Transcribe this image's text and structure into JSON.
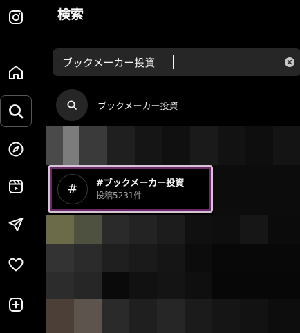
{
  "sidebar": {
    "items": [
      {
        "name": "instagram-logo",
        "icon": "instagram-icon"
      },
      {
        "name": "home",
        "icon": "home-icon"
      },
      {
        "name": "search",
        "icon": "search-icon",
        "active": true
      },
      {
        "name": "explore",
        "icon": "compass-icon"
      },
      {
        "name": "reels",
        "icon": "reels-icon"
      },
      {
        "name": "messages",
        "icon": "paper-plane-icon"
      },
      {
        "name": "notifications",
        "icon": "heart-icon"
      },
      {
        "name": "create",
        "icon": "plus-square-icon"
      }
    ]
  },
  "search": {
    "title": "検索",
    "query": "ブックメーカー投資",
    "suggestion": "ブックメーカー投資"
  },
  "result": {
    "hashtag": "#ブックメーカー投資",
    "posts": "投稿5231件",
    "symbol": "#"
  },
  "colors": {
    "background": "#000000",
    "input_bg": "#262626",
    "highlight_outer": "#d6c4d6",
    "highlight_inner": "#6a2a68",
    "secondary_text": "#a8a8a8"
  }
}
